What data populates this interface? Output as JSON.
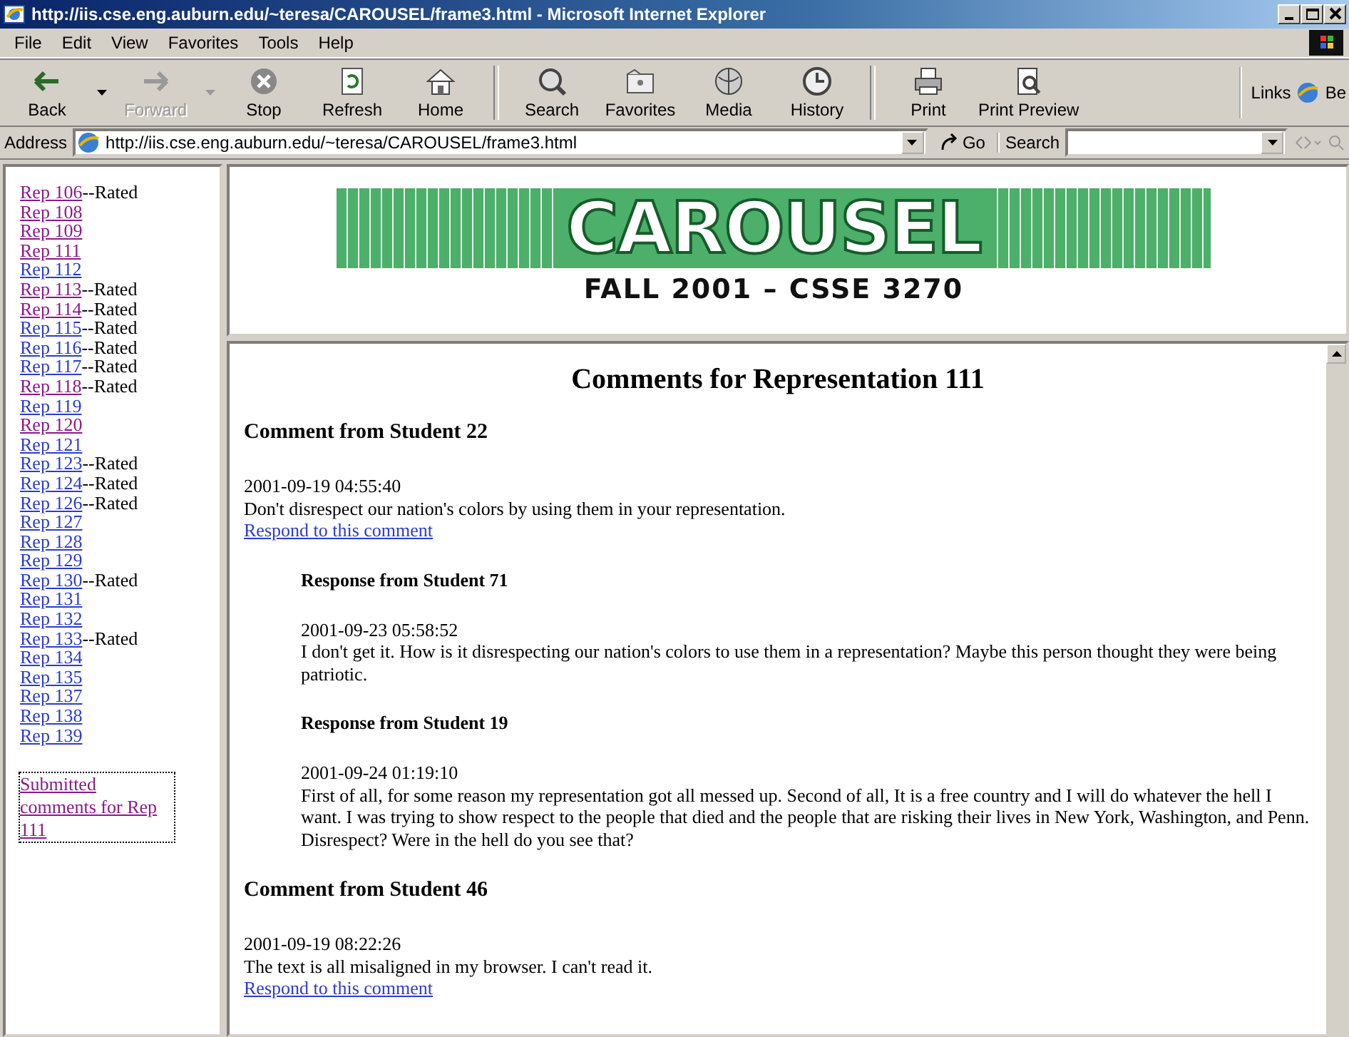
{
  "window": {
    "title": "http://iis.cse.eng.auburn.edu/~teresa/CAROUSEL/frame3.html - Microsoft Internet Explorer"
  },
  "menu": [
    "File",
    "Edit",
    "View",
    "Favorites",
    "Tools",
    "Help"
  ],
  "toolbar": {
    "groups": [
      [
        {
          "label": "Back",
          "disabled": false,
          "dropdown": true
        },
        {
          "label": "Forward",
          "disabled": true,
          "dropdown": true
        },
        {
          "label": "Stop",
          "disabled": false,
          "dropdown": false
        },
        {
          "label": "Refresh",
          "disabled": false,
          "dropdown": false
        },
        {
          "label": "Home",
          "disabled": false,
          "dropdown": false
        }
      ],
      [
        {
          "label": "Search",
          "disabled": false,
          "dropdown": false
        },
        {
          "label": "Favorites",
          "disabled": false,
          "dropdown": false
        },
        {
          "label": "Media",
          "disabled": false,
          "dropdown": false
        },
        {
          "label": "History",
          "disabled": false,
          "dropdown": false
        }
      ],
      [
        {
          "label": "Print",
          "disabled": false,
          "dropdown": false
        },
        {
          "label": "Print Preview",
          "disabled": false,
          "dropdown": false
        }
      ]
    ],
    "links_label": "Links",
    "links_item": "Be"
  },
  "address": {
    "label": "Address",
    "value": "http://iis.cse.eng.auburn.edu/~teresa/CAROUSEL/frame3.html",
    "go": "Go",
    "search_label": "Search"
  },
  "sidebar": {
    "items": [
      {
        "link": "Rep 106",
        "visited": true,
        "note": "--Rated"
      },
      {
        "link": "Rep 108",
        "visited": true
      },
      {
        "link": "Rep 109",
        "visited": true
      },
      {
        "link": "Rep 111",
        "visited": true
      },
      {
        "link": "Rep 112",
        "visited": false
      },
      {
        "link": "Rep 113",
        "visited": true,
        "note": "--Rated"
      },
      {
        "link": "Rep 114",
        "visited": true,
        "note": "--Rated"
      },
      {
        "link": "Rep 115",
        "visited": false,
        "note": "--Rated"
      },
      {
        "link": "Rep 116",
        "visited": false,
        "note": "--Rated"
      },
      {
        "link": "Rep 117",
        "visited": false,
        "note": "--Rated"
      },
      {
        "link": "Rep 118",
        "visited": true,
        "note": "--Rated"
      },
      {
        "link": "Rep 119",
        "visited": false
      },
      {
        "link": "Rep 120",
        "visited": true
      },
      {
        "link": "Rep 121",
        "visited": false
      },
      {
        "link": "Rep 123",
        "visited": false,
        "note": "--Rated"
      },
      {
        "link": "Rep 124",
        "visited": false,
        "note": "--Rated"
      },
      {
        "link": "Rep 126",
        "visited": false,
        "note": "--Rated"
      },
      {
        "link": "Rep 127",
        "visited": false
      },
      {
        "link": "Rep 128",
        "visited": false
      },
      {
        "link": "Rep 129",
        "visited": false
      },
      {
        "link": "Rep 130",
        "visited": false,
        "note": "--Rated"
      },
      {
        "link": "Rep 131",
        "visited": false
      },
      {
        "link": "Rep 132",
        "visited": false
      },
      {
        "link": "Rep 133",
        "visited": false,
        "note": "--Rated"
      },
      {
        "link": "Rep 134",
        "visited": false
      },
      {
        "link": "Rep 135",
        "visited": false
      },
      {
        "link": "Rep 137",
        "visited": false
      },
      {
        "link": "Rep 138",
        "visited": false
      },
      {
        "link": "Rep 139",
        "visited": false
      }
    ],
    "submitted": {
      "label": "Submitted comments for Rep 111",
      "visited": true,
      "focused": true
    }
  },
  "banner": {
    "logo": "CAROUSEL",
    "subtitle": "FALL 2001 – CSSE 3270"
  },
  "page": {
    "heading": "Comments for Representation 111",
    "comments": [
      {
        "author": "Comment from Student 22",
        "time": "2001-09-19 04:55:40",
        "text": "Don't disrespect our nation's colors by using them in your representation.",
        "respond": "Respond to this comment",
        "responses": [
          {
            "author": "Response from Student 71",
            "time": "2001-09-23 05:58:52",
            "text": "I don't get it. How is it disrespecting our nation's colors to use them in a representation? Maybe this person thought they were being patriotic."
          },
          {
            "author": "Response from Student 19",
            "time": "2001-09-24 01:19:10",
            "text": "First of all, for some reason my representation got all messed up. Second of all, It is a free country and I will do whatever the hell I want. I was trying to show respect to the people that died and the people that are risking their lives in New York, Washington, and Penn. Disrespect? Were in the hell do you see that?"
          }
        ]
      },
      {
        "author": "Comment from Student 46",
        "time": "2001-09-19 08:22:26",
        "text": "The text is all misaligned in my browser. I can't read it.",
        "respond": "Respond to this comment"
      }
    ]
  }
}
